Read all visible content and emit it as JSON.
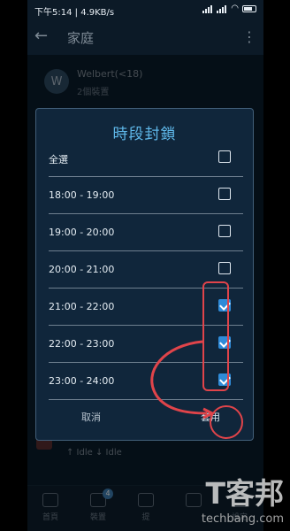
{
  "status_bar": {
    "time": "下午5:14",
    "speed": "4.9KB/s",
    "network": "4G"
  },
  "app_bar": {
    "title": "家庭"
  },
  "device": {
    "avatar": "W",
    "name": "Welbert(<18)",
    "count": "2個裝置"
  },
  "dialog": {
    "title": "時段封鎖",
    "rows": [
      {
        "label": "全選",
        "checked": false
      },
      {
        "label": "18:00 - 19:00",
        "checked": false
      },
      {
        "label": "19:00 - 20:00",
        "checked": false
      },
      {
        "label": "20:00 - 21:00",
        "checked": false
      },
      {
        "label": "21:00 - 22:00",
        "checked": true
      },
      {
        "label": "22:00 - 23:00",
        "checked": true
      },
      {
        "label": "23:00 - 24:00",
        "checked": true
      }
    ],
    "cancel_label": "取消",
    "apply_label": "套用"
  },
  "background": {
    "idle_text": "↑ Idle  ↓ Idle"
  },
  "bottom_nav": {
    "items": [
      {
        "label": "首頁"
      },
      {
        "label": "裝置",
        "badge": "4"
      },
      {
        "label": "提"
      },
      {
        "label": ""
      },
      {
        "label": "設定"
      }
    ]
  },
  "watermark": {
    "line1": "T客邦",
    "line2": "techbang.com"
  },
  "colors": {
    "dialog_bg": "#10263b",
    "accent": "#2f8bd8",
    "title": "#5fb8ea",
    "annotation": "#e0444a"
  }
}
